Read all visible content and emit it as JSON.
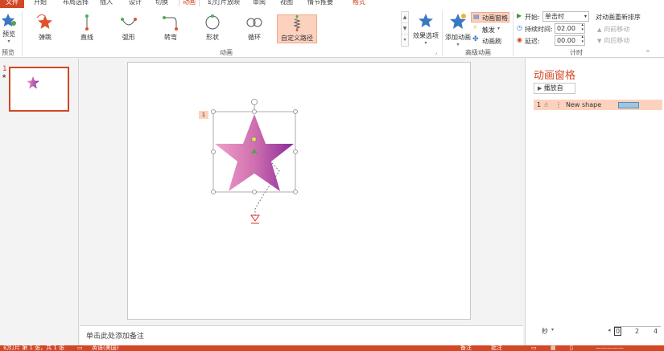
{
  "tabs": {
    "file": "文件",
    "items": [
      {
        "label": "开始",
        "state": "normal"
      },
      {
        "label": "布局选择",
        "state": "normal"
      },
      {
        "label": "插入",
        "state": "normal"
      },
      {
        "label": "设计",
        "state": "normal"
      },
      {
        "label": "切换",
        "state": "normal"
      },
      {
        "label": "动画",
        "state": "active"
      },
      {
        "label": "幻灯片放映",
        "state": "normal"
      },
      {
        "label": "审阅",
        "state": "normal"
      },
      {
        "label": "视图",
        "state": "normal"
      },
      {
        "label": "情节推要",
        "state": "normal"
      },
      {
        "label": "格式",
        "state": "red"
      }
    ]
  },
  "ribbon": {
    "preview": {
      "label": "预览",
      "group": "预览"
    },
    "animations": [
      {
        "label": "弹跳",
        "icon": "star-bounce-icon",
        "selected": false
      },
      {
        "label": "直线",
        "icon": "line-path-icon",
        "selected": false
      },
      {
        "label": "弧形",
        "icon": "arc-path-icon",
        "selected": false
      },
      {
        "label": "转弯",
        "icon": "turn-path-icon",
        "selected": false
      },
      {
        "label": "形状",
        "icon": "shape-path-icon",
        "selected": false
      },
      {
        "label": "循环",
        "icon": "loop-path-icon",
        "selected": false
      },
      {
        "label": "自定义路径",
        "icon": "custom-path-icon",
        "selected": true
      }
    ],
    "animation_group": "动画",
    "effect_options": "效果选项",
    "add_animation": "添加动画",
    "anim_pane": "动画窗格",
    "trigger": "触发",
    "anim_painter": "动画刷",
    "advanced_group": "高级动画",
    "start_label": "开始:",
    "start_value": "单击时",
    "duration_label": "持续时间:",
    "duration_value": "02.00",
    "delay_label": "延迟:",
    "delay_value": "00.00",
    "reorder_title": "对动画重新排序",
    "move_earlier": "向前移动",
    "move_later": "向后移动",
    "timing_group": "计时"
  },
  "thumbs": {
    "number": "1",
    "star": "★"
  },
  "slide": {
    "anim_tag": "1"
  },
  "notes": "单击此处添加备注",
  "pane": {
    "title": "动画窗格",
    "play_button": "播放自",
    "item_number": "1",
    "item_name": "New shape",
    "seconds_label": "秒",
    "timeline": [
      "0",
      "2",
      "4"
    ]
  },
  "status": {
    "slide_info": "幻灯片 第 1 张，共 1 张",
    "language": "英语(美国)",
    "notes_btn": "备注",
    "comments_btn": "批注"
  },
  "colors": {
    "accent": "#d24726",
    "selection": "#fcd2bf",
    "star_gradient": [
      "#f0a0c8",
      "#8a2a9a"
    ]
  }
}
